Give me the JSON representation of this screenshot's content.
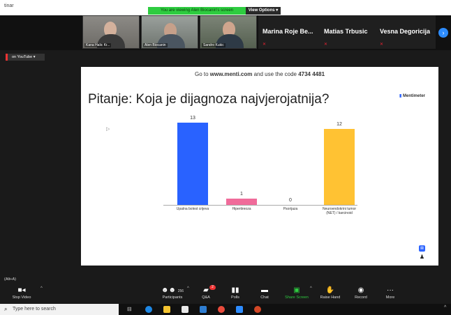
{
  "window": {
    "title": "tinar"
  },
  "banner": {
    "viewing": "You are viewing Alen Biocanin's screen",
    "view_options": "View Options ▾"
  },
  "participants": [
    {
      "name": "Kana Halic Kr..."
    },
    {
      "name": "Alen Biocanin"
    },
    {
      "name": "Sandro Kukic"
    }
  ],
  "name_tiles": [
    {
      "name": "Marina Roje Be..."
    },
    {
      "name": "Matias Trbusic"
    },
    {
      "name": "Vesna Degoricija"
    }
  ],
  "side": {
    "youtube": "on YouTube ▾",
    "shortcut": "(Alt+A)"
  },
  "slide": {
    "header_prefix": "Go to ",
    "header_site": "www.menti.com",
    "header_mid": " and use the code ",
    "header_code": "4734 4481",
    "question": "Pitanje: Koja je dijagnoza najvjerojatnija?",
    "logo": "Mentimeter"
  },
  "chart_data": {
    "type": "bar",
    "categories": [
      "Upalna bolest crijeva",
      "Hipertireoza",
      "Psorijaza",
      "Neuroendokrini tumor (NET) / karcinoid"
    ],
    "values": [
      13,
      1,
      0,
      12
    ],
    "colors": [
      "#2962ff",
      "#f06b9a",
      "#999999",
      "#ffc233"
    ],
    "ylim": [
      0,
      13
    ]
  },
  "toolbar": {
    "stop_video": "Stop Video",
    "participants": "Participants",
    "participants_count": "256",
    "qa": "Q&A",
    "polls": "Polls",
    "chat": "Chat",
    "share_screen": "Share Screen",
    "raise_hand": "Raise Hand",
    "record": "Record",
    "more": "More"
  },
  "taskbar": {
    "search_placeholder": "Type here to search"
  }
}
